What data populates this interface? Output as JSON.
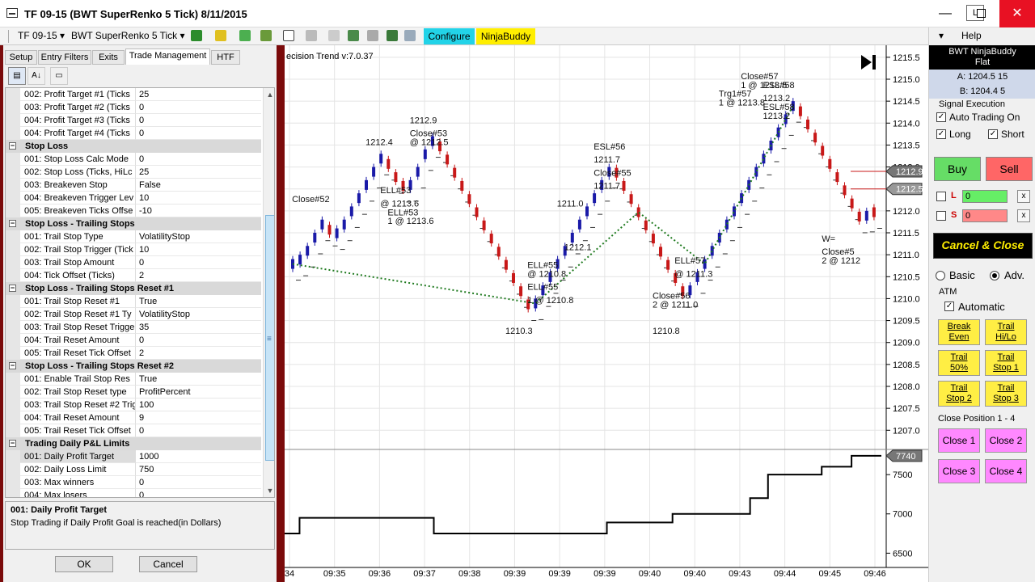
{
  "window": {
    "title": "TF 09-15 (BWT SuperRenko  5 Tick)  8/11/2015",
    "link_button": "L",
    "minimize": "—",
    "close": "✕"
  },
  "toolbar": {
    "instrument": "TF 09-15",
    "bar_type": "BWT SuperRenko  5 Tick",
    "configure": "Configure",
    "ninjabuddy": "NinjaBuddy",
    "configure_color": "#22d3e8",
    "ninjabuddy_color": "#ffee00"
  },
  "dialog": {
    "tabs": [
      "Setup",
      "Entry Filters",
      "Exits",
      "Trade Management",
      "HTF"
    ],
    "active_tab": "Trade Management",
    "rows": [
      {
        "kind": "prop",
        "label": "002:  Profit Target #1 (Ticks",
        "value": "25"
      },
      {
        "kind": "prop",
        "label": "003:  Profit Target #2 (Ticks",
        "value": "0"
      },
      {
        "kind": "prop",
        "label": "004:  Profit Target #3 (Ticks",
        "value": "0"
      },
      {
        "kind": "prop",
        "label": "004:  Profit Target #4 (Ticks",
        "value": "0"
      },
      {
        "kind": "cat",
        "label": "Stop Loss"
      },
      {
        "kind": "prop",
        "label": "001:  Stop Loss Calc Mode",
        "value": "0"
      },
      {
        "kind": "prop",
        "label": "002:  Stop Loss (Ticks, HiLc",
        "value": "25"
      },
      {
        "kind": "prop",
        "label": "003:  Breakeven Stop",
        "value": "False"
      },
      {
        "kind": "prop",
        "label": "004:  Breakeven Trigger Lev",
        "value": "10"
      },
      {
        "kind": "prop",
        "label": "005:  Breakeven Ticks Offse",
        "value": "-10"
      },
      {
        "kind": "cat",
        "label": "Stop Loss - Trailing Stops"
      },
      {
        "kind": "prop",
        "label": "001:  Trail Stop Type",
        "value": "VolatilityStop"
      },
      {
        "kind": "prop",
        "label": "002:  Trail Stop Trigger (Tick",
        "value": "10"
      },
      {
        "kind": "prop",
        "label": "003:  Trail Stop Amount",
        "value": "0"
      },
      {
        "kind": "prop",
        "label": "004:  Tick Offset (Ticks)",
        "value": "2"
      },
      {
        "kind": "cat",
        "label": "Stop Loss - Trailing Stops Reset #1"
      },
      {
        "kind": "prop",
        "label": "001:  Trail Stop Reset #1",
        "value": "True"
      },
      {
        "kind": "prop",
        "label": "002:  Trail Stop Reset #1 Ty",
        "value": "VolatilityStop"
      },
      {
        "kind": "prop",
        "label": "003:  Trail Stop Reset Trigge",
        "value": "35"
      },
      {
        "kind": "prop",
        "label": "004:  Trail Reset Amount",
        "value": "0"
      },
      {
        "kind": "prop",
        "label": "005:  Trail Reset Tick Offset",
        "value": "2"
      },
      {
        "kind": "cat",
        "label": "Stop Loss - Trailing Stops Reset #2"
      },
      {
        "kind": "prop",
        "label": "001:  Enable Trail Stop Res",
        "value": "True"
      },
      {
        "kind": "prop",
        "label": "002:  Trail Stop Reset type",
        "value": "ProfitPercent"
      },
      {
        "kind": "prop",
        "label": "003:  Trail Stop Reset #2 Trig",
        "value": "100"
      },
      {
        "kind": "prop",
        "label": "004:  Trail Reset Amount",
        "value": "9"
      },
      {
        "kind": "prop",
        "label": "005:  Trail Reset Tick Offset",
        "value": "0"
      },
      {
        "kind": "cat",
        "label": "Trading Daily P&L Limits"
      },
      {
        "kind": "prop",
        "label": "001:  Daily Profit Target",
        "value": "1000",
        "selected": true
      },
      {
        "kind": "prop",
        "label": "002:  Daily Loss Limit",
        "value": "750"
      },
      {
        "kind": "prop",
        "label": "003:  Max winners",
        "value": "0"
      },
      {
        "kind": "prop",
        "label": "004:  Max losers",
        "value": "0"
      }
    ],
    "description_title": "001:  Daily Profit Target",
    "description_text": "Stop Trading if Daily Profit Goal is reached(in Dollars)",
    "ok": "OK",
    "cancel": "Cancel"
  },
  "chart_data": {
    "type": "bar",
    "title": "ecision Trend v:7.0.37",
    "price_axis": [
      "1215.5",
      "1215.0",
      "1214.5",
      "1214.0",
      "1213.5",
      "1213.0",
      "1212.5",
      "1212.0",
      "1211.5",
      "1211.0",
      "1210.5",
      "1210.0",
      "1209.5",
      "1209.0",
      "1208.5",
      "1208.0",
      "1207.5",
      "1207.0"
    ],
    "price_range": [
      1206.6,
      1215.7
    ],
    "current_price_tags": [
      "1212.9",
      "1212.5"
    ],
    "time_axis": [
      "34",
      "09:35",
      "09:36",
      "09:37",
      "09:38",
      "09:39",
      "09:39",
      "09:39",
      "09:40",
      "09:40",
      "09:43",
      "09:44",
      "09:45",
      "09:46"
    ],
    "equity_axis": [
      "7500",
      "7000",
      "6500"
    ],
    "equity_range": [
      6380,
      7800
    ],
    "equity_tag": "7740",
    "equity_steps": [
      [
        0,
        6750
      ],
      [
        0.025,
        6750
      ],
      [
        0.025,
        6950
      ],
      [
        0.25,
        6950
      ],
      [
        0.25,
        6750
      ],
      [
        0.54,
        6750
      ],
      [
        0.54,
        6890
      ],
      [
        0.65,
        6890
      ],
      [
        0.65,
        7000
      ],
      [
        0.78,
        7000
      ],
      [
        0.78,
        7200
      ],
      [
        0.81,
        7200
      ],
      [
        0.81,
        7500
      ],
      [
        0.9,
        7500
      ],
      [
        0.9,
        7600
      ],
      [
        0.95,
        7600
      ],
      [
        0.95,
        7740
      ],
      [
        1.0,
        7740
      ]
    ],
    "bricks": [
      {
        "d": "u",
        "p": 1210.9
      },
      {
        "d": "u",
        "p": 1211.0
      },
      {
        "d": "u",
        "p": 1211.2
      },
      {
        "d": "u",
        "p": 1211.5
      },
      {
        "d": "u",
        "p": 1211.8
      },
      {
        "d": "d",
        "p": 1211.4
      },
      {
        "d": "u",
        "p": 1211.6
      },
      {
        "d": "u",
        "p": 1211.8
      },
      {
        "d": "u",
        "p": 1212.1
      },
      {
        "d": "u",
        "p": 1212.4
      },
      {
        "d": "u",
        "p": 1212.7
      },
      {
        "d": "u",
        "p": 1213.0
      },
      {
        "d": "u",
        "p": 1213.3
      },
      {
        "d": "d",
        "p": 1212.9
      },
      {
        "d": "d",
        "p": 1212.6
      },
      {
        "d": "d",
        "p": 1212.4
      },
      {
        "d": "u",
        "p": 1212.7
      },
      {
        "d": "u",
        "p": 1213.0
      },
      {
        "d": "u",
        "p": 1213.4
      },
      {
        "d": "u",
        "p": 1213.7
      },
      {
        "d": "d",
        "p": 1213.3
      },
      {
        "d": "d",
        "p": 1213.0
      },
      {
        "d": "d",
        "p": 1212.7
      },
      {
        "d": "d",
        "p": 1212.4
      },
      {
        "d": "d",
        "p": 1212.1
      },
      {
        "d": "d",
        "p": 1211.8
      },
      {
        "d": "d",
        "p": 1211.5
      },
      {
        "d": "d",
        "p": 1211.2
      },
      {
        "d": "d",
        "p": 1210.9
      },
      {
        "d": "d",
        "p": 1210.6
      },
      {
        "d": "d",
        "p": 1210.3
      },
      {
        "d": "d",
        "p": 1210.0
      },
      {
        "d": "d",
        "p": 1209.7
      },
      {
        "d": "u",
        "p": 1210.0
      },
      {
        "d": "u",
        "p": 1210.3
      },
      {
        "d": "u",
        "p": 1210.6
      },
      {
        "d": "u",
        "p": 1210.9
      },
      {
        "d": "u",
        "p": 1211.2
      },
      {
        "d": "u",
        "p": 1211.5
      },
      {
        "d": "u",
        "p": 1211.8
      },
      {
        "d": "u",
        "p": 1212.1
      },
      {
        "d": "u",
        "p": 1212.4
      },
      {
        "d": "u",
        "p": 1212.7
      },
      {
        "d": "u",
        "p": 1213.0
      },
      {
        "d": "d",
        "p": 1212.7
      },
      {
        "d": "d",
        "p": 1212.4
      },
      {
        "d": "d",
        "p": 1212.1
      },
      {
        "d": "d",
        "p": 1211.8
      },
      {
        "d": "d",
        "p": 1211.5
      },
      {
        "d": "d",
        "p": 1211.2
      },
      {
        "d": "d",
        "p": 1210.9
      },
      {
        "d": "d",
        "p": 1210.6
      },
      {
        "d": "d",
        "p": 1210.3
      },
      {
        "d": "d",
        "p": 1210.0
      },
      {
        "d": "u",
        "p": 1210.3
      },
      {
        "d": "u",
        "p": 1210.6
      },
      {
        "d": "u",
        "p": 1210.9
      },
      {
        "d": "u",
        "p": 1211.2
      },
      {
        "d": "u",
        "p": 1211.5
      },
      {
        "d": "u",
        "p": 1211.8
      },
      {
        "d": "u",
        "p": 1212.1
      },
      {
        "d": "u",
        "p": 1212.4
      },
      {
        "d": "u",
        "p": 1212.7
      },
      {
        "d": "u",
        "p": 1213.0
      },
      {
        "d": "u",
        "p": 1213.3
      },
      {
        "d": "u",
        "p": 1213.6
      },
      {
        "d": "u",
        "p": 1213.9
      },
      {
        "d": "u",
        "p": 1214.2
      },
      {
        "d": "u",
        "p": 1214.5
      },
      {
        "d": "d",
        "p": 1214.1
      },
      {
        "d": "d",
        "p": 1213.8
      },
      {
        "d": "d",
        "p": 1213.5
      },
      {
        "d": "d",
        "p": 1213.2
      },
      {
        "d": "d",
        "p": 1212.9
      },
      {
        "d": "d",
        "p": 1212.6
      },
      {
        "d": "d",
        "p": 1212.3
      },
      {
        "d": "d",
        "p": 1212.0
      },
      {
        "d": "d",
        "p": 1211.7
      },
      {
        "d": "u",
        "p": 1212.0
      },
      {
        "d": "d",
        "p": 1211.8
      }
    ],
    "annotations": [
      {
        "text": "Close#52",
        "x": 1,
        "price": 1212.2
      },
      {
        "text": "1212.4",
        "x": 11,
        "price": 1213.5
      },
      {
        "text": "ELL#53",
        "x": 13,
        "price": 1212.4
      },
      {
        "text": "@ 1213.6",
        "x": 13,
        "price": 1212.1
      },
      {
        "text": "ELL#53",
        "x": 14,
        "price": 1211.9
      },
      {
        "text": "1 @ 1213.6",
        "x": 14,
        "price": 1211.7
      },
      {
        "text": "1212.9",
        "x": 17,
        "price": 1214.0
      },
      {
        "text": "Close#53",
        "x": 17,
        "price": 1213.7
      },
      {
        "text": "@ 1212.5",
        "x": 17,
        "price": 1213.5
      },
      {
        "text": "1210.3",
        "x": 30,
        "price": 1209.2
      },
      {
        "text": "ELL#55",
        "x": 33,
        "price": 1210.7
      },
      {
        "text": "@ 1210.8",
        "x": 33,
        "price": 1210.5
      },
      {
        "text": "ELL#55",
        "x": 33,
        "price": 1210.2
      },
      {
        "text": "1 @ 1210.8",
        "x": 33,
        "price": 1209.9
      },
      {
        "text": "1211.0",
        "x": 37,
        "price": 1212.1
      },
      {
        "text": "1212.1",
        "x": 38,
        "price": 1211.1
      },
      {
        "text": "ESL#56",
        "x": 42,
        "price": 1213.4
      },
      {
        "text": "1211.7",
        "x": 42,
        "price": 1213.1
      },
      {
        "text": "Close#55",
        "x": 42,
        "price": 1212.8
      },
      {
        "text": "1211.7",
        "x": 42,
        "price": 1212.5
      },
      {
        "text": "Close#56",
        "x": 50,
        "price": 1210.0
      },
      {
        "text": "2 @ 1211.0",
        "x": 50,
        "price": 1209.8
      },
      {
        "text": "1210.8",
        "x": 50,
        "price": 1209.2
      },
      {
        "text": "ELL#57",
        "x": 53,
        "price": 1210.8
      },
      {
        "text": "@ 1211.3",
        "x": 53,
        "price": 1210.5
      },
      {
        "text": "Close#57",
        "x": 62,
        "price": 1215.0
      },
      {
        "text": "1 @ 1213.5",
        "x": 62,
        "price": 1214.8
      },
      {
        "text": "Trg1#57",
        "x": 59,
        "price": 1214.6
      },
      {
        "text": "1 @ 1213.8",
        "x": 59,
        "price": 1214.4
      },
      {
        "text": "ESL#58",
        "x": 65,
        "price": 1214.8
      },
      {
        "text": "1213.2",
        "x": 65,
        "price": 1214.5
      },
      {
        "text": "ESL#58",
        "x": 65,
        "price": 1214.3
      },
      {
        "text": "1213.2",
        "x": 65,
        "price": 1214.1
      },
      {
        "text": "W=",
        "x": 73,
        "price": 1211.3
      },
      {
        "text": "Close#5",
        "x": 73,
        "price": 1211.0
      },
      {
        "text": "2 @ 1212",
        "x": 73,
        "price": 1210.8
      }
    ]
  },
  "panel": {
    "menu": "▾",
    "help": "Help",
    "header_line1": "BWT NinjaBuddy",
    "header_line2": "Flat",
    "ask": "A:  1204.5 15",
    "bid": "B:  1204.4 5",
    "signal_execution": "Signal Execution",
    "auto_trading": "Auto Trading On",
    "long": "Long",
    "short": "Short",
    "buy": "Buy",
    "sell": "Sell",
    "buy_color": "#66dd66",
    "sell_color": "#ff6666",
    "qty_long_label": "L",
    "qty_short_label": "S",
    "qty_long": "0",
    "qty_short": "0",
    "x": "x",
    "cancel_close": "Cancel & Close",
    "basic": "Basic",
    "adv": "Adv.",
    "atm": "ATM",
    "automatic": "Automatic",
    "break_even_1": "Break",
    "break_even_2": "Even",
    "trail_hilo_1": "Trail",
    "trail_hilo_2": "Hi/Lo",
    "trail_50_1": "Trail",
    "trail_50_2": "50%",
    "trail_stop1_1": "Trail",
    "trail_stop1_2": "Stop 1",
    "trail_stop2_1": "Trail",
    "trail_stop2_2": "Stop 2",
    "trail_stop3_1": "Trail",
    "trail_stop3_2": "Stop 3",
    "close_position": "Close Position 1 - 4",
    "close1": "Close 1",
    "close2": "Close 2",
    "close3": "Close 3",
    "close4": "Close 4"
  }
}
